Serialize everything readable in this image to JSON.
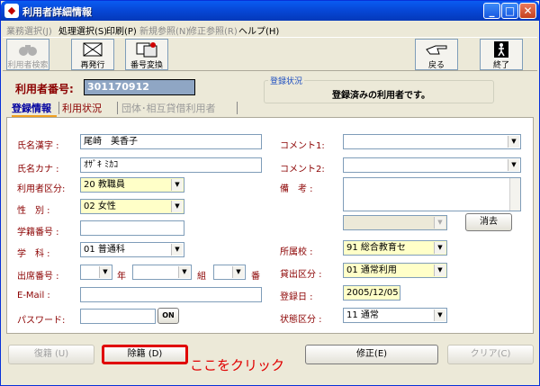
{
  "window": {
    "title": "利用者詳細情報"
  },
  "menu": [
    {
      "label": "業務選択(J)",
      "enabled": false
    },
    {
      "label": "処理選択(S)",
      "enabled": true
    },
    {
      "label": "印刷(P)",
      "enabled": true
    },
    {
      "label": "新規参照(N)",
      "enabled": false
    },
    {
      "label": "修正参照(R)",
      "enabled": false
    },
    {
      "label": "ヘルプ(H)",
      "enabled": true
    }
  ],
  "toolbar": {
    "search_label": "利用者検索",
    "reissue_label": "再発行",
    "renumber_label": "番号変換",
    "back_label": "戻る",
    "exit_label": "終了"
  },
  "header": {
    "user_number_label": "利用者番号:",
    "user_number_value": "301170912",
    "status_group_label": "登録状況",
    "status_text": "登録済みの利用者です。"
  },
  "tabs": [
    {
      "label": "登録情報",
      "active": true
    },
    {
      "label": "利用状況",
      "active": false
    },
    {
      "label": "団体･相互貸借利用者",
      "active": false
    }
  ],
  "form": {
    "name_kanji_label": "氏名漢字 :",
    "name_kanji_value": "尾崎　美香子",
    "name_kana_label": "氏名カナ :",
    "name_kana_value": "ｵｻﾞｷ ﾐｶｺ",
    "user_type_label": "利用者区分:",
    "user_type_value": "20 教職員",
    "gender_label": "性　別 :",
    "gender_value": "02 女性",
    "student_id_label": "学籍番号 :",
    "student_id_value": "",
    "department_label": "学　科 :",
    "department_value": "01 普通科",
    "attendance_label": "出席番号 :",
    "year_label": "年",
    "class_label": "組",
    "number_label": "番",
    "email_label": "E-Mail :",
    "email_value": "",
    "password_label": "パスワード:",
    "password_value": "",
    "on_button": "ON",
    "comment1_label": "コメント1:",
    "comment1_value": "",
    "comment2_label": "コメント2:",
    "comment2_value": "",
    "remarks_label": "備　考 :",
    "remarks_value": "",
    "clear_button": "消去",
    "school_label": "所属校 :",
    "school_value": "91 総合教育セ",
    "loan_type_label": "貸出区分 :",
    "loan_type_value": "01 通常利用",
    "reg_date_label": "登録日 :",
    "reg_date_value": "2005/12/05",
    "state_label": "状態区分 :",
    "state_value": "11 通常"
  },
  "bottom": {
    "reinstate_label": "復籍 (U)",
    "withdraw_label": "除籍 (D)",
    "annotation": "ここをクリック",
    "modify_label": "修正(E)",
    "clear_label": "クリア(C)"
  },
  "colors": {
    "accent": "#cc0000",
    "label": "#8b0000",
    "yellow_field": "#ffffc8",
    "annotation": "#e00000"
  }
}
